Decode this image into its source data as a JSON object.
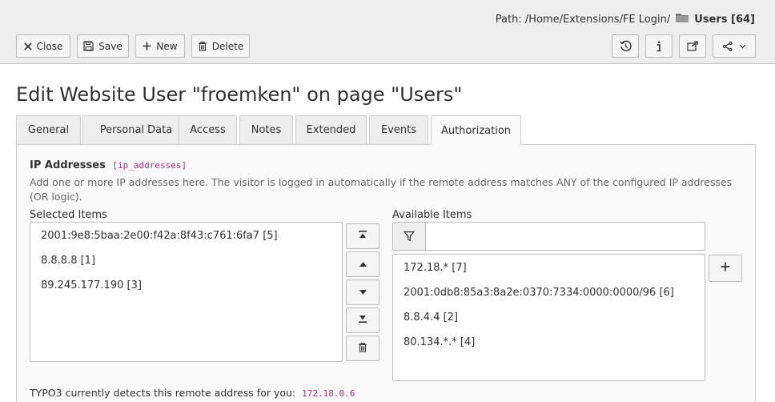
{
  "docheader": {
    "path_label": "Path: /Home/Extensions/FE Login/",
    "record_title": "Users [64]",
    "buttons": {
      "close": "Close",
      "save": "Save",
      "new": "New",
      "delete": "Delete"
    },
    "right_icons": [
      "history-icon",
      "info-icon",
      "open-new-window-icon",
      "share-icon"
    ]
  },
  "page": {
    "title": "Edit Website User \"froemken\" on page \"Users\""
  },
  "tabs": [
    {
      "label": "General",
      "active": false
    },
    {
      "label": "Personal Data",
      "active": false
    },
    {
      "label": "Access",
      "active": false
    },
    {
      "label": "Notes",
      "active": false
    },
    {
      "label": "Extended",
      "active": false
    },
    {
      "label": "Events",
      "active": false
    },
    {
      "label": "Authorization",
      "active": true
    }
  ],
  "field": {
    "label": "IP Addresses",
    "field_name": "[ip_addresses]",
    "description": "Add one or more IP addresses here. The visitor is logged in automatically if the remote address matches ANY of the configured IP addresses (OR logic).",
    "selected_label": "Selected Items",
    "available_label": "Available Items",
    "selected_items": [
      "2001:9e8:5baa:2e00:f42a:8f43:c761:6fa7 [5]",
      "8.8.8.8 [1]",
      "89.245.177.190 [3]"
    ],
    "available_items": [
      "172.18.* [7]",
      "2001:0db8:85a3:8a2e:0370:7334:0000:0000/96 [6]",
      "8.8.4.4 [2]",
      "80.134.*.* [4]"
    ],
    "filter_value": "",
    "remote_note": "TYPO3 currently detects this remote address for you:",
    "remote_address": "172.18.0.6"
  },
  "colors": {
    "header_bg": "#eeeeee",
    "code_accent": "#b0327a",
    "panel_bg": "#fafafa"
  }
}
